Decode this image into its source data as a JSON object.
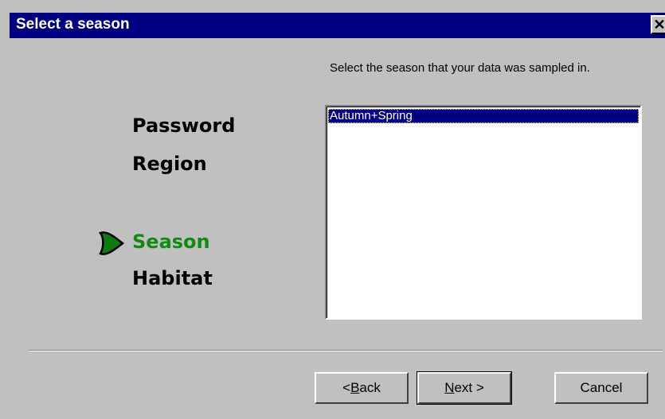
{
  "window": {
    "title": "Select a season",
    "close_glyph": "✕"
  },
  "steps": [
    {
      "label": "Password"
    },
    {
      "label": "Region"
    },
    {
      "label": "Season"
    },
    {
      "label": "Habitat"
    }
  ],
  "active_step_icon": "arrow-pointer-icon",
  "instruction": "Select the season that your data was sampled in.",
  "list": {
    "items": [
      "Autumn+Spring"
    ],
    "selected": "Autumn+Spring"
  },
  "buttons": {
    "back_prefix": "< ",
    "back_mnemonic": "B",
    "back_rest": "ack",
    "next_mnemonic": "N",
    "next_rest": "ext >",
    "cancel": "Cancel"
  },
  "colors": {
    "titlebar": "#000080",
    "active_step": "#128a12",
    "selection": "#000080",
    "face": "#c0c0c0"
  }
}
